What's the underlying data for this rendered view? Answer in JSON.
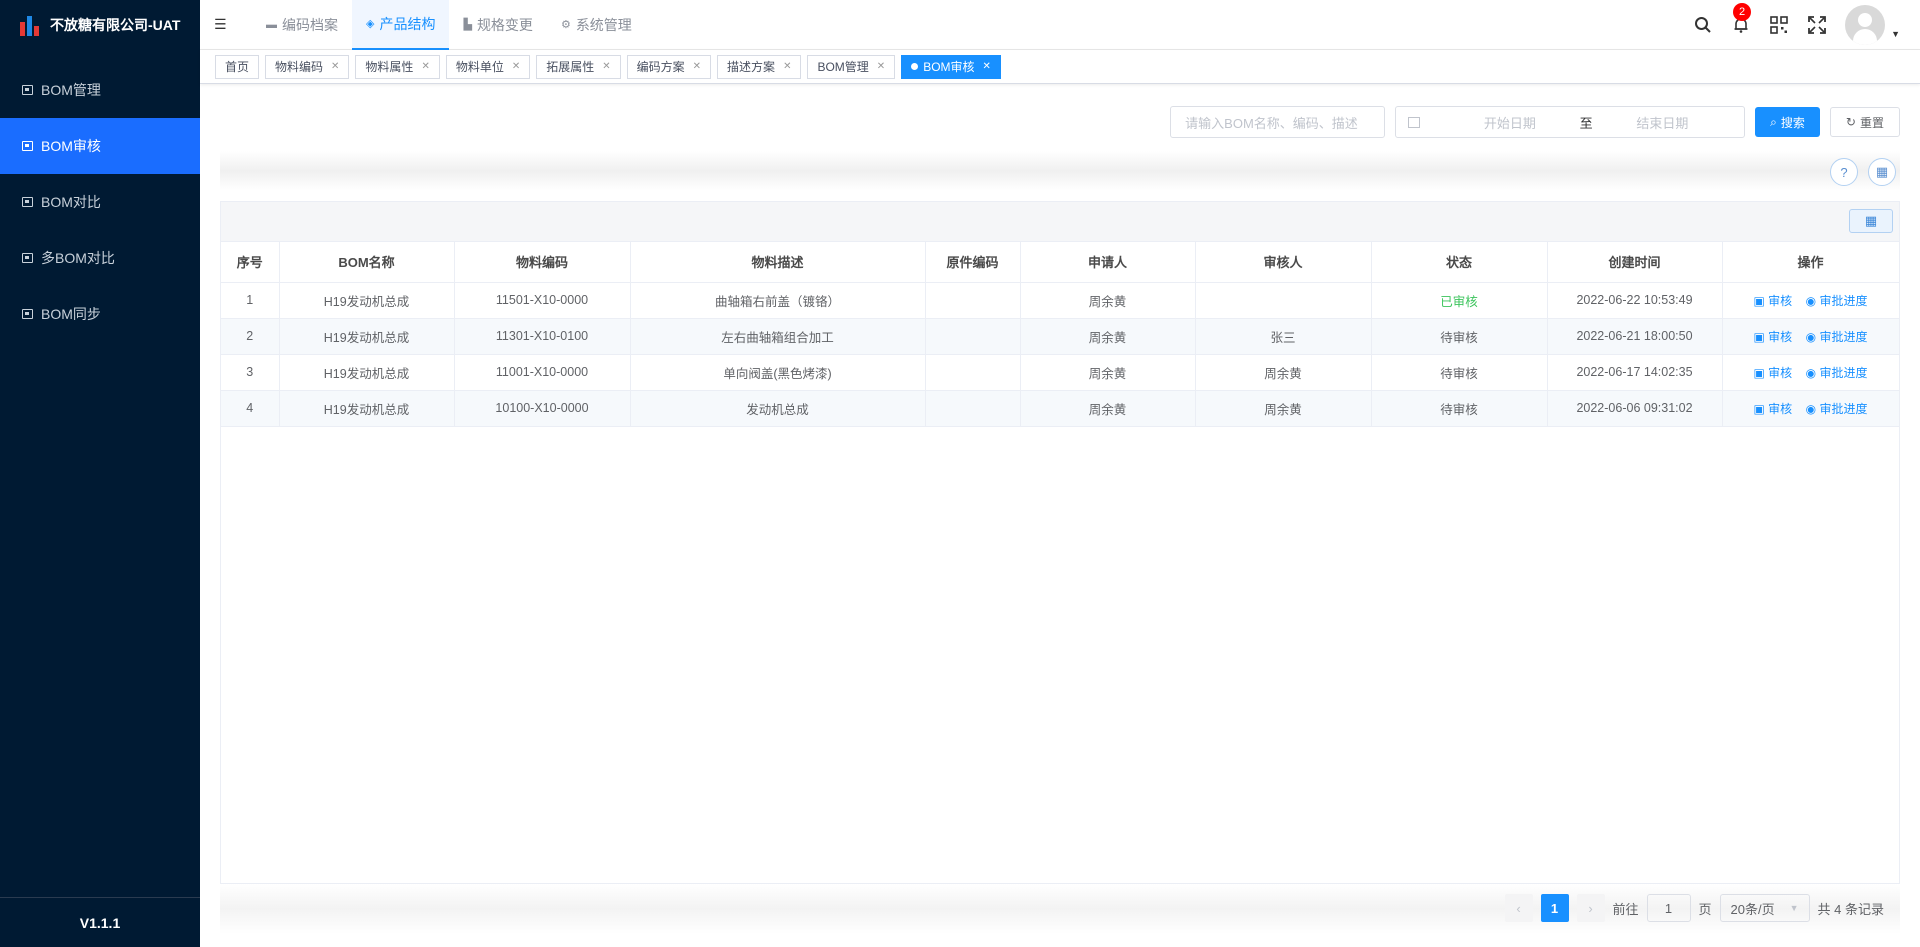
{
  "app": {
    "title": "不放糖有限公司-UAT",
    "version": "V1.1.1"
  },
  "sidebar": {
    "items": [
      {
        "label": "BOM管理",
        "active": false
      },
      {
        "label": "BOM审核",
        "active": true
      },
      {
        "label": "BOM对比",
        "active": false
      },
      {
        "label": "多BOM对比",
        "active": false
      },
      {
        "label": "BOM同步",
        "active": false
      }
    ]
  },
  "header": {
    "collapse_icon": "menu-fold-icon",
    "nav": [
      {
        "label": "编码档案",
        "icon": "folder-icon"
      },
      {
        "label": "产品结构",
        "icon": "layers-icon",
        "active": true
      },
      {
        "label": "规格变更",
        "icon": "chart-icon"
      },
      {
        "label": "系统管理",
        "icon": "gear-icon"
      }
    ],
    "notification_count": "2"
  },
  "tags": [
    {
      "label": "首页",
      "closable": false
    },
    {
      "label": "物料编码",
      "closable": true
    },
    {
      "label": "物料属性",
      "closable": true
    },
    {
      "label": "物料单位",
      "closable": true
    },
    {
      "label": "拓展属性",
      "closable": true
    },
    {
      "label": "编码方案",
      "closable": true
    },
    {
      "label": "描述方案",
      "closable": true
    },
    {
      "label": "BOM管理",
      "closable": true
    },
    {
      "label": "BOM审核",
      "closable": true,
      "active": true
    }
  ],
  "search": {
    "placeholder": "请输入BOM名称、编码、描述",
    "start_placeholder": "开始日期",
    "separator": "至",
    "end_placeholder": "结束日期",
    "search_label": "搜索",
    "reset_label": "重置"
  },
  "table": {
    "columns": [
      "序号",
      "BOM名称",
      "物料编码",
      "物料描述",
      "原件编码",
      "申请人",
      "审核人",
      "状态",
      "创建时间",
      "操作"
    ],
    "rows": [
      {
        "idx": "1",
        "bom_name": "H19发动机总成",
        "code": "11501-X10-0000",
        "desc": "曲轴箱右前盖（镀铬）",
        "orig_code": "",
        "applicant": "周余黄",
        "reviewer": "",
        "status": "已审核",
        "status_ok": true,
        "created": "2022-06-22 10:53:49"
      },
      {
        "idx": "2",
        "bom_name": "H19发动机总成",
        "code": "11301-X10-0100",
        "desc": "左右曲轴箱组合加工",
        "orig_code": "",
        "applicant": "周余黄",
        "reviewer": "张三",
        "status": "待审核",
        "status_ok": false,
        "created": "2022-06-21 18:00:50"
      },
      {
        "idx": "3",
        "bom_name": "H19发动机总成",
        "code": "11001-X10-0000",
        "desc": "单向阀盖(黑色烤漆)",
        "orig_code": "",
        "applicant": "周余黄",
        "reviewer": "周余黄",
        "status": "待审核",
        "status_ok": false,
        "created": "2022-06-17 14:02:35"
      },
      {
        "idx": "4",
        "bom_name": "H19发动机总成",
        "code": "10100-X10-0000",
        "desc": "发动机总成",
        "orig_code": "",
        "applicant": "周余黄",
        "reviewer": "周余黄",
        "status": "待审核",
        "status_ok": false,
        "created": "2022-06-06 09:31:02"
      }
    ],
    "actions": {
      "review": "审核",
      "progress": "审批进度"
    }
  },
  "pagination": {
    "current": "1",
    "goto_prefix": "前往",
    "goto_value": "1",
    "goto_suffix": "页",
    "page_size": "20条/页",
    "total": "共 4 条记录"
  },
  "colors": {
    "sidebar_bg": "#001a33",
    "accent": "#1890ff",
    "active_menu": "#1a6dff",
    "success": "#3cc45c"
  }
}
